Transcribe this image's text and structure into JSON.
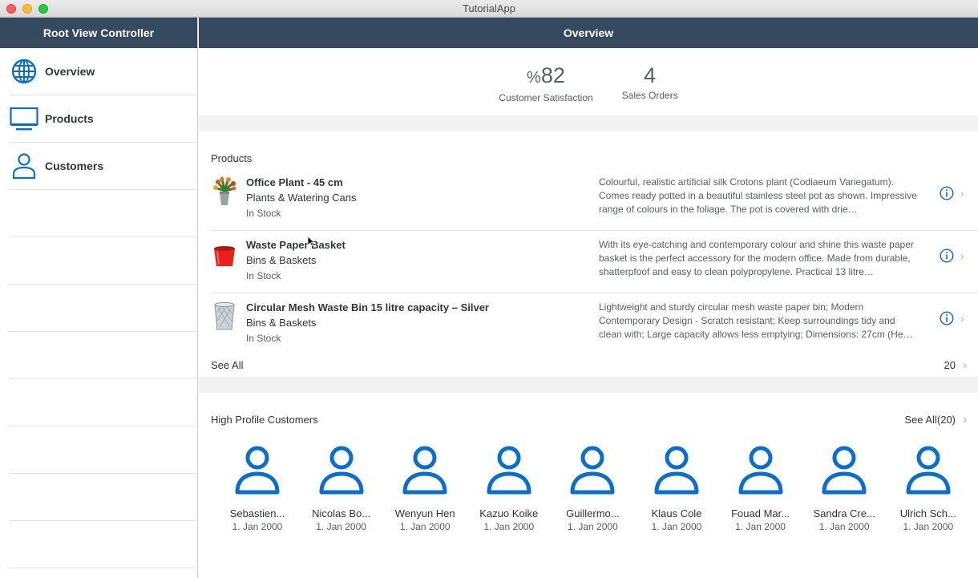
{
  "window": {
    "title": "TutorialApp"
  },
  "sidebar": {
    "header": "Root View Controller",
    "items": [
      {
        "label": "Overview",
        "icon": "globe-icon"
      },
      {
        "label": "Products",
        "icon": "monitor-icon"
      },
      {
        "label": "Customers",
        "icon": "person-icon"
      }
    ]
  },
  "main": {
    "header": "Overview",
    "kpis": [
      {
        "unit": "%",
        "value": "82",
        "label": "Customer Satisfaction"
      },
      {
        "unit": "",
        "value": "4",
        "label": "Sales Orders"
      }
    ],
    "products": {
      "title": "Products",
      "items": [
        {
          "name": "Office Plant - 45 cm",
          "category": "Plants & Watering Cans",
          "status": "In Stock",
          "description": "Colourful, realistic artificial silk Crotons plant (Codiaeum Variegatum). Comes ready potted in a beautiful stainless steel pot as shown. Impressive range of colours in the foliage. The pot is covered with drie…"
        },
        {
          "name": "Waste Paper Basket",
          "category": "Bins & Baskets",
          "status": "In Stock",
          "description": "With its eye-catching and contemporary colour and shine this waste paper basket is the perfect accessory for the modern office. Made from durable, shatterpfoof and easy to clean polypropylene. Practical 13 litre…"
        },
        {
          "name": "Circular Mesh Waste Bin 15 litre capacity – Silver",
          "category": "Bins & Baskets",
          "status": "In Stock",
          "description": "Lightweight and sturdy circular mesh waste paper bin; Modern Contemporary Design - Scratch resistant; Keep surroundings tidy and clean with; Large capacity allows less emptying; Dimensions: 27cm (He…"
        }
      ],
      "see_all_label": "See All",
      "count": "20"
    },
    "customers": {
      "title": "High Profile Customers",
      "see_all_label": "See All(20)",
      "items": [
        {
          "name": "Sebastien...",
          "date": "1. Jan 2000"
        },
        {
          "name": "Nicolas Bo...",
          "date": "1. Jan 2000"
        },
        {
          "name": "Wenyun Hen",
          "date": "1. Jan 2000"
        },
        {
          "name": "Kazuo Koike",
          "date": "1. Jan 2000"
        },
        {
          "name": "Guillermo...",
          "date": "1. Jan 2000"
        },
        {
          "name": "Klaus Cole",
          "date": "1. Jan 2000"
        },
        {
          "name": "Fouad Mar...",
          "date": "1. Jan 2000"
        },
        {
          "name": "Sandra Cre...",
          "date": "1. Jan 2000"
        },
        {
          "name": "Ulrich Sch...",
          "date": "1. Jan 2000"
        }
      ]
    }
  },
  "colors": {
    "header": "#354a5f",
    "accent": "#0a6ed1",
    "spacer": "#f2f2f2"
  }
}
